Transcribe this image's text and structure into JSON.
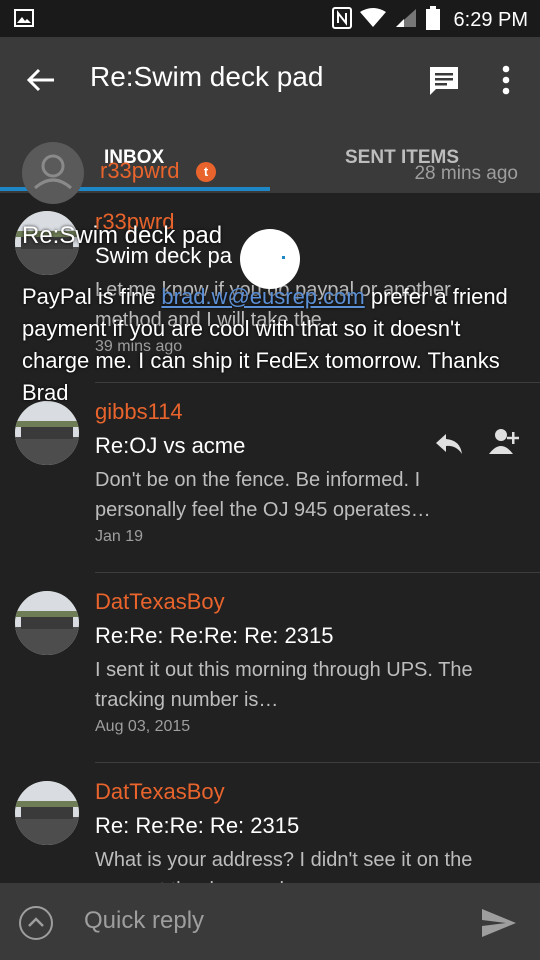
{
  "status": {
    "time": "6:29 PM"
  },
  "header": {
    "title": "Re:Swim deck pad"
  },
  "tabs": [
    {
      "label": "INBOX"
    },
    {
      "label": "SENT ITEMS"
    }
  ],
  "overlay": {
    "sender": "r33pwrd",
    "badge": "t",
    "time": "28 mins ago",
    "title": "Re:Swim deck pad",
    "body_before": "PayPal is fine ",
    "email": "brad.w@eusrep.com",
    "body_after": " prefer a friend payment if you are cool with that so it doesn't charge me. I can ship it FedEx tomorrow. Thanks Brad"
  },
  "messages": [
    {
      "sender": "r33pwrd",
      "subject": "Swim deck pa",
      "preview": "Let me know if you do paypal or another method and I will take the...",
      "date": "39 mins ago"
    },
    {
      "sender": "gibbs114",
      "subject": "Re:OJ vs acme",
      "preview": "Don't be on the fence. Be informed. I personally feel the OJ 945 operates…",
      "date": "Jan 19"
    },
    {
      "sender": "DatTexasBoy",
      "subject": "Re:Re: Re:Re: Re: 2315",
      "preview": "I sent it out this morning through UPS. The tracking number is…",
      "date": "Aug 03, 2015"
    },
    {
      "sender": "DatTexasBoy",
      "subject": "Re: Re:Re: Re: 2315",
      "preview": "What is your address? I didn't see it on the account thanks man h…",
      "date": ""
    }
  ],
  "quick_reply": {
    "placeholder": "Quick reply"
  },
  "colors": {
    "accent": "#1e88c7",
    "sender": "#e8642c",
    "background": "#212121",
    "bar": "#3a3a3a"
  }
}
